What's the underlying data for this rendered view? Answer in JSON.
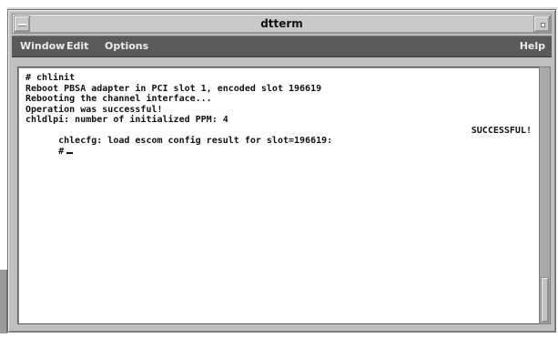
{
  "window": {
    "title": "dtterm"
  },
  "menubar": {
    "items": [
      "Window",
      "Edit",
      "Options"
    ],
    "help": "Help"
  },
  "terminal": {
    "lines": [
      "# chlinit",
      "Reboot PBSA adapter in PCI slot 1, encoded slot 196619",
      "Rebooting the channel interface...",
      "Operation was successful!",
      "chldlpi: number of initialized PPM: 4",
      "chlecfg: load escom config result for slot=196619:",
      "#"
    ],
    "status_right": "SUCCESSFUL!"
  },
  "scroll": {
    "position": 1.0
  }
}
